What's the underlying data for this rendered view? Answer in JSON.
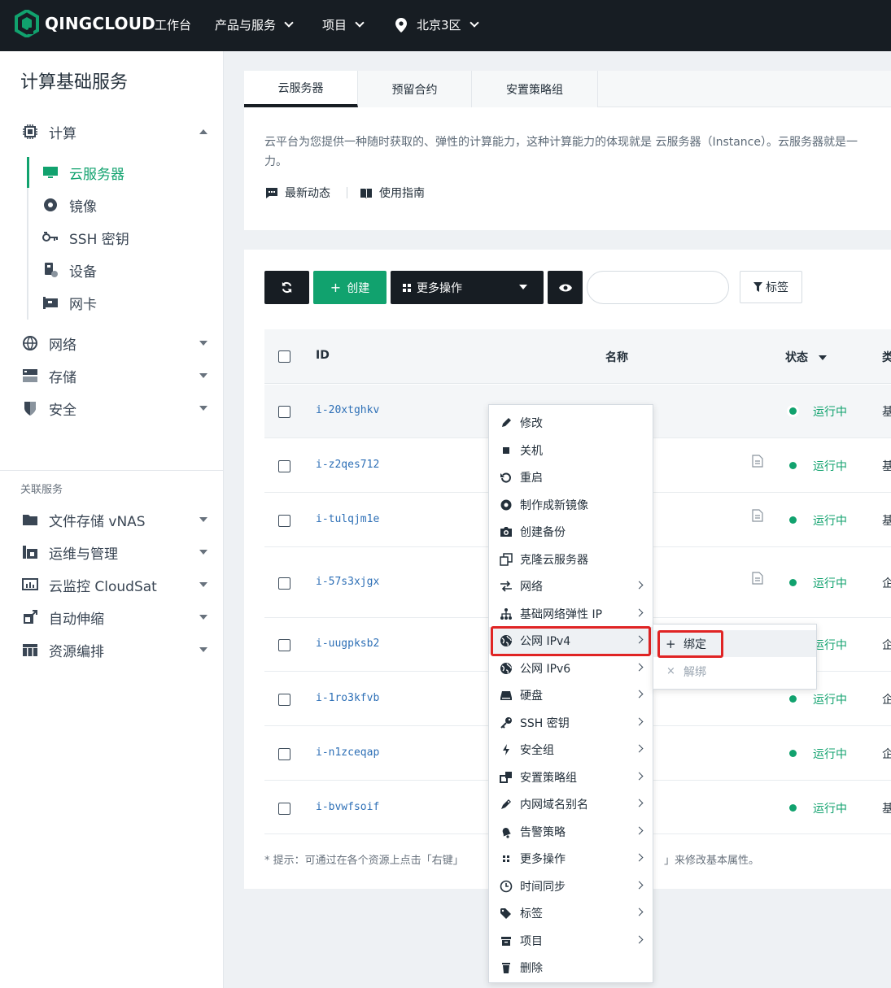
{
  "topbar": {
    "brand": "QINGCLOUD",
    "nav": [
      {
        "label": "工作台",
        "has_dropdown": false
      },
      {
        "label": "产品与服务",
        "has_dropdown": true
      },
      {
        "label": "项目",
        "has_dropdown": true
      },
      {
        "label": "北京3区",
        "has_dropdown": true,
        "icon": "location-pin-icon"
      }
    ]
  },
  "sidebar": {
    "title": "计算基础服务",
    "compute": {
      "label": "计算",
      "expanded": true,
      "icon": "chip-icon"
    },
    "compute_items": [
      {
        "label": "云服务器",
        "icon": "monitor-icon",
        "active": true
      },
      {
        "label": "镜像",
        "icon": "disc-icon"
      },
      {
        "label": "SSH 密钥",
        "icon": "key-icon"
      },
      {
        "label": "设备",
        "icon": "device-icon"
      },
      {
        "label": "网卡",
        "icon": "nic-icon"
      }
    ],
    "groups": [
      {
        "label": "网络",
        "icon": "network-icon"
      },
      {
        "label": "存储",
        "icon": "storage-icon"
      },
      {
        "label": "安全",
        "icon": "shield-icon"
      }
    ],
    "related_title": "关联服务",
    "related": [
      {
        "label": "文件存储 vNAS",
        "icon": "folder-icon"
      },
      {
        "label": "运维与管理",
        "icon": "ops-icon"
      },
      {
        "label": "云监控 CloudSat",
        "icon": "monitor-chart-icon"
      },
      {
        "label": "自动伸缩",
        "icon": "scale-icon"
      },
      {
        "label": "资源编排",
        "icon": "orchestration-icon"
      }
    ]
  },
  "tabs": [
    "云服务器",
    "预留合约",
    "安置策略组"
  ],
  "description": {
    "line1": "云平台为您提供一种随时获取的、弹性的计算能力，这种计算能力的体现就是 云服务器（Instance）。云服务器就是一",
    "line2": "力。",
    "links": [
      "最新动态",
      "使用指南"
    ]
  },
  "toolbar": {
    "refresh_icon": "refresh-icon",
    "create": "创建",
    "more_actions": "更多操作",
    "tags": "标签",
    "search_placeholder": ""
  },
  "table": {
    "headers": {
      "id": "ID",
      "name": "名称",
      "status": "状态",
      "truncated": "类"
    },
    "rows": [
      {
        "id": "i-20xtghkv",
        "status": "运行中",
        "type_trunc": "基",
        "has_doc": false
      },
      {
        "id": "i-z2qes712",
        "status": "运行中",
        "type_trunc": "基",
        "has_doc": true
      },
      {
        "id": "i-tulqjm1e",
        "status": "运行中",
        "type_trunc": "基",
        "has_doc": true
      },
      {
        "id": "i-57s3xjgx",
        "status": "运行中",
        "type_trunc": "企",
        "has_doc": true
      },
      {
        "id": "i-uugpksb2",
        "status": "运行中",
        "type_trunc": "企",
        "has_doc": false
      },
      {
        "id": "i-1ro3kfvb",
        "status": "运行中",
        "type_trunc": "企",
        "has_doc": false
      },
      {
        "id": "i-n1zceqap",
        "status": "运行中",
        "type_trunc": "企",
        "has_doc": false
      },
      {
        "id": "i-bvwfsoif",
        "status": "运行中",
        "type_trunc": "基",
        "has_doc": false
      }
    ],
    "tip_left": "* 提示：可通过在各个资源上点击「右键」",
    "tip_right": "」来修改基本属性。"
  },
  "context_menu": {
    "items": [
      {
        "label": "修改",
        "icon": "pencil-icon",
        "submenu": false
      },
      {
        "label": "关机",
        "icon": "stop-icon",
        "submenu": false
      },
      {
        "label": "重启",
        "icon": "restart-icon",
        "submenu": false
      },
      {
        "label": "制作成新镜像",
        "icon": "image-disc-icon",
        "submenu": false
      },
      {
        "label": "创建备份",
        "icon": "camera-icon",
        "submenu": false
      },
      {
        "label": "克隆云服务器",
        "icon": "clone-icon",
        "submenu": false
      },
      {
        "label": "网络",
        "icon": "network-arrows-icon",
        "submenu": true
      },
      {
        "label": "基础网络弹性 IP",
        "icon": "topology-icon",
        "submenu": true
      },
      {
        "label": "公网 IPv4",
        "icon": "globe-icon",
        "submenu": true,
        "highlighted": true
      },
      {
        "label": "公网 IPv6",
        "icon": "globe-icon",
        "submenu": true
      },
      {
        "label": "硬盘",
        "icon": "disk-icon",
        "submenu": true
      },
      {
        "label": "SSH 密钥",
        "icon": "key-icon",
        "submenu": true
      },
      {
        "label": "安全组",
        "icon": "bolt-icon",
        "submenu": true
      },
      {
        "label": "安置策略组",
        "icon": "placement-icon",
        "submenu": true
      },
      {
        "label": "内网域名别名",
        "icon": "tag-pen-icon",
        "submenu": true
      },
      {
        "label": "告警策略",
        "icon": "bell-icon",
        "submenu": true
      },
      {
        "label": "更多操作",
        "icon": "grid-icon",
        "submenu": true
      },
      {
        "label": "时间同步",
        "icon": "clock-icon",
        "submenu": true
      },
      {
        "label": "标签",
        "icon": "tags-icon",
        "submenu": true
      },
      {
        "label": "项目",
        "icon": "archive-icon",
        "submenu": true
      },
      {
        "label": "删除",
        "icon": "trash-icon",
        "submenu": false
      }
    ]
  },
  "submenu": {
    "items": [
      {
        "label": "绑定",
        "icon": "plus-icon",
        "highlighted": true
      },
      {
        "label": "解绑",
        "icon": "x-icon",
        "disabled": true
      }
    ]
  },
  "colors": {
    "brand_green": "#11a26e",
    "topbar": "#171d23",
    "highlight_box": "#e02424",
    "link_blue": "#2d6fb6"
  }
}
